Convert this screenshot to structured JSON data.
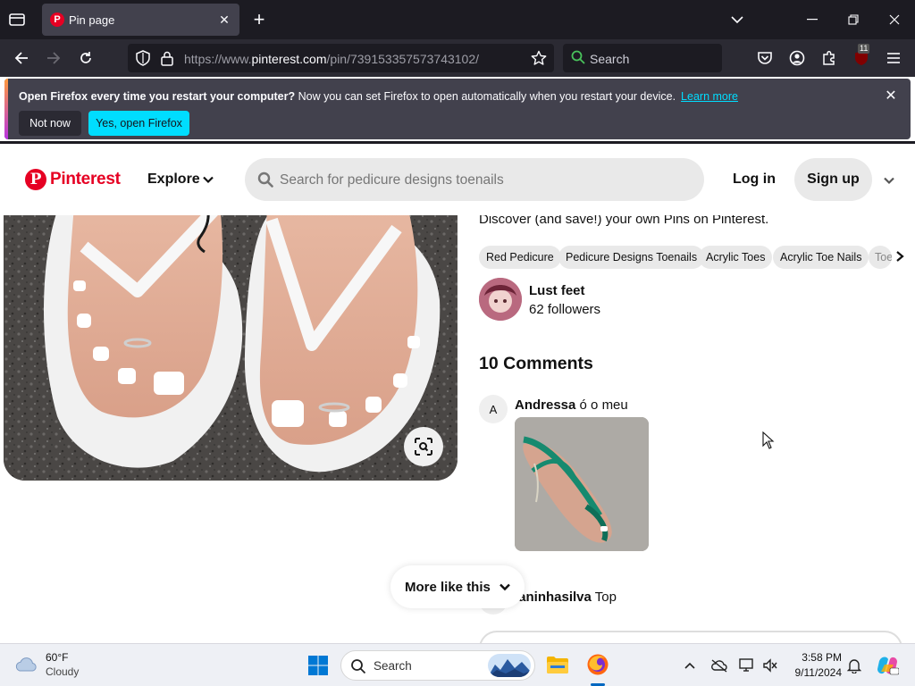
{
  "browser": {
    "tab_title": "Pin page",
    "url_prefix": "https://www.",
    "url_domain": "pinterest.com",
    "url_path": "/pin/739153357573743102/",
    "search_placeholder": "Search",
    "extension_badge": "11"
  },
  "notification": {
    "headline": "Open Firefox every time you restart your computer?",
    "body": "Now you can set Firefox to open automatically when you restart your device.",
    "link": "Learn more",
    "not_now": "Not now",
    "yes_open": "Yes, open Firefox"
  },
  "pinterest": {
    "logo_text": "Pinterest",
    "explore": "Explore",
    "search_placeholder": "Search for pedicure designs toenails",
    "login": "Log in",
    "signup": "Sign up",
    "discover": "Discover (and save!) your own Pins on Pinterest.",
    "chips": [
      "Red Pedicure",
      "Pedicure Designs Toenails",
      "Acrylic Toes",
      "Acrylic Toe Nails",
      "Toe"
    ],
    "creator": {
      "name": "Lust feet",
      "followers": "62 followers"
    },
    "comments_title": "10 Comments",
    "comments": [
      {
        "avatar_letter": "A",
        "author": "Andressa",
        "text": "ó o meu"
      },
      {
        "author": "laninhasilva",
        "text": "Top"
      }
    ],
    "more_like_this": "More like this"
  },
  "taskbar": {
    "weather_temp": "60°F",
    "weather_desc": "Cloudy",
    "search_label": "Search",
    "time": "3:58 PM",
    "date": "9/11/2024"
  }
}
